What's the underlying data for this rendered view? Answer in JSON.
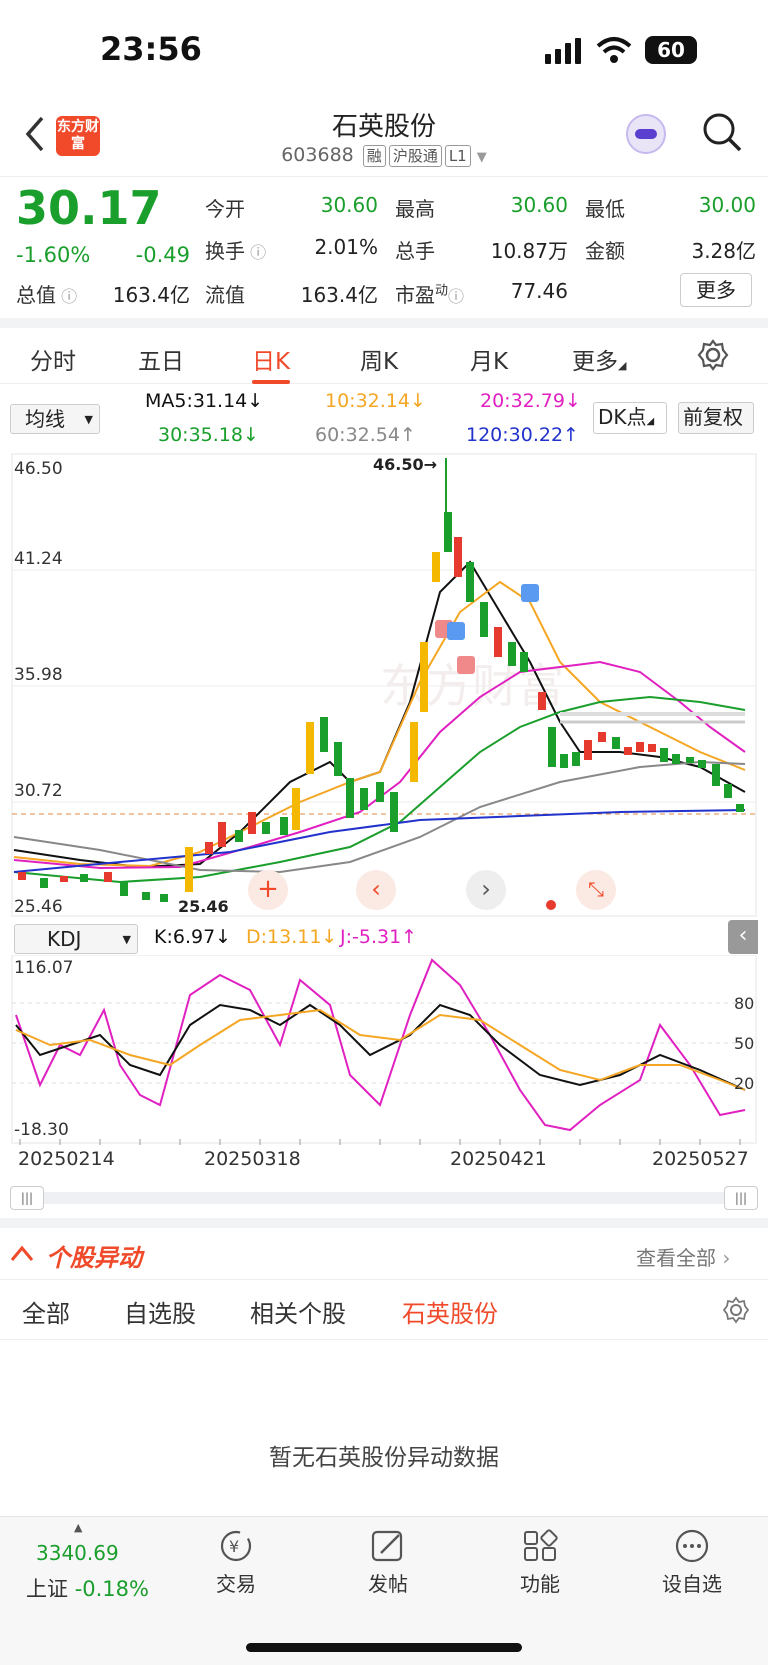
{
  "status": {
    "time": "23:56",
    "battery": "60"
  },
  "header": {
    "title": "石英股份",
    "code": "603688",
    "tags": [
      "融",
      "沪股通",
      "L1"
    ],
    "logo_text": "东方财富"
  },
  "quote": {
    "price": "30.17",
    "change_pct": "-1.60%",
    "change": "-0.49",
    "open_label": "今开",
    "open": "30.60",
    "high_label": "最高",
    "high": "30.60",
    "low_label": "最低",
    "low": "30.00",
    "turnover_label": "换手",
    "turnover": "2.01%",
    "volume_label": "总手",
    "volume": "10.87万",
    "amount_label": "金额",
    "amount": "3.28亿",
    "mcap_label": "总值",
    "mcap": "163.4亿",
    "float_label": "流值",
    "float": "163.4亿",
    "pe_label": "市盈",
    "pe_sup": "动",
    "pe": "77.46",
    "more": "更多"
  },
  "tabs": [
    "分时",
    "五日",
    "日K",
    "周K",
    "月K",
    "更多"
  ],
  "ma": {
    "selector": "均线",
    "ma5": "MA5:31.14↓",
    "ma10": "10:32.14↓",
    "ma20": "20:32.79↓",
    "ma30": "30:35.18↓",
    "ma60": "60:32.54↑",
    "ma120": "120:30.22↑",
    "dk": "DK点",
    "fq": "前复权"
  },
  "kchart": {
    "price_labels": [
      "46.50",
      "41.24",
      "35.98",
      "30.72",
      "25.46"
    ],
    "high_mark": "46.50→",
    "low_mark": "25.46",
    "watermark": "东方财富"
  },
  "kdj": {
    "selector": "KDJ",
    "k": "K:6.97↓",
    "d": "D:13.11↓",
    "j": "J:-5.31↑",
    "top": "116.07",
    "bottom": "-18.30",
    "levels": [
      "80",
      "50",
      "20"
    ]
  },
  "dates": [
    "20250214",
    "20250318",
    "20250421",
    "20250527"
  ],
  "panel": {
    "title": "个股异动",
    "view_all": "查看全部"
  },
  "subtabs": [
    "全部",
    "自选股",
    "相关个股",
    "石英股份"
  ],
  "empty_text": "暂无石英股份异动数据",
  "bottom": {
    "index_value": "3340.69",
    "index_name": "上证",
    "index_change": "-0.18%",
    "items": [
      "交易",
      "发帖",
      "功能",
      "设自选"
    ]
  },
  "colors": {
    "up": "#e63a2e",
    "down": "#1a9e2c",
    "accent": "#f04a2a",
    "ma5": "#111111",
    "ma10": "#f5a623",
    "ma20": "#e020c0",
    "ma30": "#1a9e2c",
    "ma60": "#888888",
    "ma120": "#2233cc"
  }
}
